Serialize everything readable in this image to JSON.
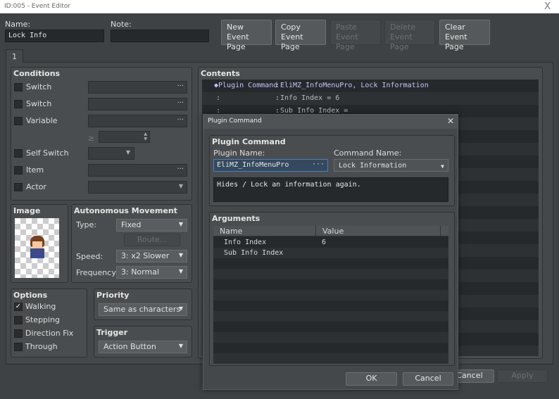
{
  "window": {
    "title": "ID:005 - Event Editor",
    "close": "X"
  },
  "header": {
    "name_label": "Name:",
    "name_value": "Lock Info",
    "note_label": "Note:",
    "note_value": "",
    "buttons": [
      {
        "l1": "New",
        "l2": "Event Page"
      },
      {
        "l1": "Copy",
        "l2": "Event Page"
      },
      {
        "l1": "Paste",
        "l2": "Event Page"
      },
      {
        "l1": "Delete",
        "l2": "Event Page"
      },
      {
        "l1": "Clear",
        "l2": "Event Page"
      }
    ]
  },
  "tabs": [
    "1"
  ],
  "conditions": {
    "title": "Conditions",
    "items": [
      "Switch",
      "Switch",
      "Variable",
      "Self Switch",
      "Item",
      "Actor"
    ],
    "dots": "···",
    "variable_op": "≥"
  },
  "image": {
    "title": "Image"
  },
  "autonomous": {
    "title": "Autonomous Movement",
    "type_label": "Type:",
    "type_value": "Fixed",
    "route_label": "Route...",
    "speed_label": "Speed:",
    "speed_value": "3: x2 Slower",
    "freq_label": "Frequency:",
    "freq_value": "3: Normal"
  },
  "options": {
    "title": "Options",
    "items": [
      {
        "label": "Walking",
        "checked": true
      },
      {
        "label": "Stepping",
        "checked": false
      },
      {
        "label": "Direction Fix",
        "checked": false
      },
      {
        "label": "Through",
        "checked": false
      }
    ],
    "check": "✓"
  },
  "priority": {
    "title": "Priority",
    "value": "Same as characters"
  },
  "trigger": {
    "title": "Trigger",
    "value": "Action Button"
  },
  "contents": {
    "title": "Contents",
    "rows": [
      {
        "head": "◆Plugin Command",
        "sep": ":",
        "text": "EliMZ_InfoMenuPro, Lock Information"
      },
      {
        "head": ":",
        "sep": ":",
        "text": "Info Index = 6"
      },
      {
        "head": ":",
        "sep": ":",
        "text": "Sub Info Index ="
      }
    ]
  },
  "footer": {
    "cancel": "Cancel",
    "apply": "Apply"
  },
  "dialog": {
    "title": "Plugin Command",
    "close": "✕",
    "group_title": "Plugin Command",
    "plugin_label": "Plugin Name:",
    "plugin_value": "EliMZ_InfoMenuPro",
    "command_label": "Command Name:",
    "command_value": "Lock Information",
    "description": "Hides / Lock an information again.",
    "args_title": "Arguments",
    "columns": [
      "Name",
      "Value"
    ],
    "args": [
      {
        "name": "Info Index",
        "value": "6"
      },
      {
        "name": "Sub Info Index",
        "value": ""
      }
    ],
    "ok": "OK",
    "cancel": "Cancel"
  }
}
